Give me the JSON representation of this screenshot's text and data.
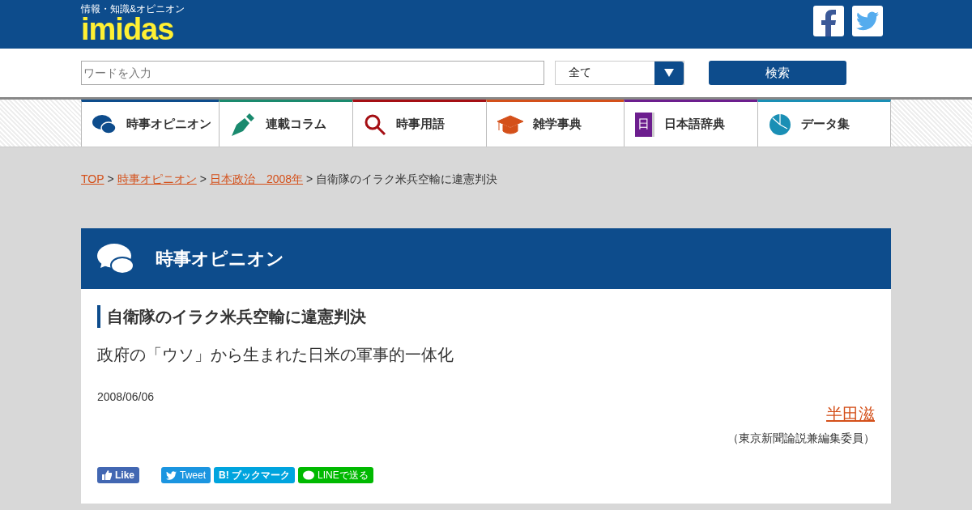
{
  "header": {
    "tagline": "情報・知識&オピニオン",
    "logo": "imidas"
  },
  "search": {
    "placeholder": "ワードを入力",
    "category": "全て",
    "button": "検索"
  },
  "nav": [
    {
      "kind": "bubbles",
      "label": "時事オピニオン",
      "color": "#0d4c8c"
    },
    {
      "kind": "pen",
      "label": "連載コラム",
      "color": "#1a8a6e"
    },
    {
      "kind": "magnifier",
      "label": "時事用語",
      "color": "#a50f14"
    },
    {
      "kind": "cap",
      "label": "雑学事典",
      "color": "#d4501a"
    },
    {
      "kind": "book",
      "label": "日本語辞典",
      "color": "#6c1e8e",
      "icon_text": "日"
    },
    {
      "kind": "pie",
      "label": "データ集",
      "color": "#1a8fb5"
    }
  ],
  "breadcrumb": {
    "separator": ">",
    "links": [
      "TOP",
      "時事オピニオン",
      "日本政治　2008年"
    ],
    "current": "自衛隊のイラク米兵空輸に違憲判決"
  },
  "section": {
    "title": "時事オピニオン"
  },
  "article": {
    "title": "自衛隊のイラク米兵空輸に違憲判決",
    "subtitle": "政府の「ウソ」から生まれた日米の軍事的一体化",
    "date": "2008/06/06",
    "author": "半田滋",
    "author_role": "（東京新聞論説兼編集委員）"
  },
  "share": [
    {
      "kind": "like",
      "label": "Like"
    },
    {
      "kind": "tweet",
      "label": "Tweet"
    },
    {
      "kind": "hatena",
      "label": "B! ブックマーク"
    },
    {
      "kind": "line",
      "label": "LINEで送る"
    }
  ]
}
